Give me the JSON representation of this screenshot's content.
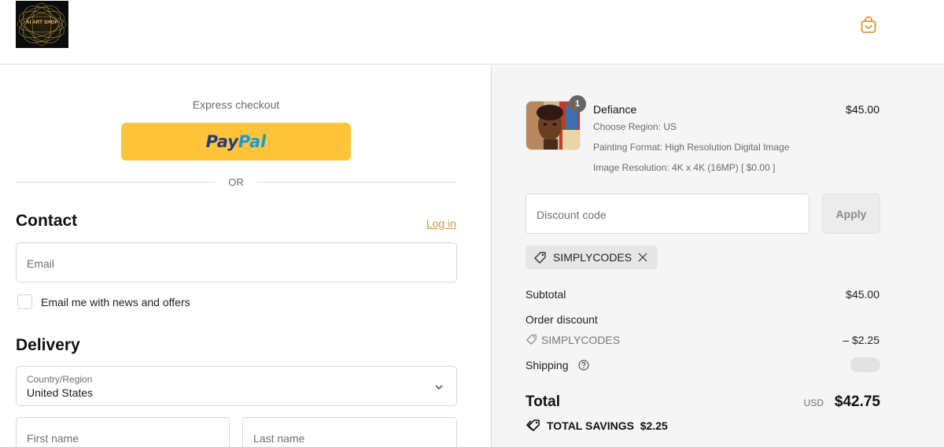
{
  "header": {
    "logo_text": "AI ART SHOP",
    "cart_icon": "shopping-bag-icon",
    "accent_color": "#d59a2a"
  },
  "express": {
    "label": "Express checkout",
    "paypal_a": "Pay",
    "paypal_b": "Pal",
    "or": "OR"
  },
  "contact": {
    "title": "Contact",
    "login": "Log in",
    "email_placeholder": "Email",
    "newsletter_label": "Email me with news and offers"
  },
  "delivery": {
    "title": "Delivery",
    "country_label": "Country/Region",
    "country_value": "United States",
    "first_name_placeholder": "First name",
    "last_name_placeholder": "Last name"
  },
  "order": {
    "quantity": "1",
    "item_name": "Defiance",
    "item_price": "$45.00",
    "meta": [
      "Choose Region: US",
      "Painting Format: High Resolution Digital Image",
      "Image Resolution: 4K x 4K (16MP) [ $0.00 ]"
    ],
    "discount_placeholder": "Discount code",
    "apply_label": "Apply",
    "applied_code": "SIMPLYCODES"
  },
  "summary": {
    "subtotal_label": "Subtotal",
    "subtotal_value": "$45.00",
    "order_discount_label": "Order discount",
    "discount_code": "SIMPLYCODES",
    "discount_value": "– $2.25",
    "shipping_label": "Shipping",
    "total_label": "Total",
    "currency": "USD",
    "total_value": "$42.75",
    "savings_text": "TOTAL SAVINGS  $2.25"
  }
}
